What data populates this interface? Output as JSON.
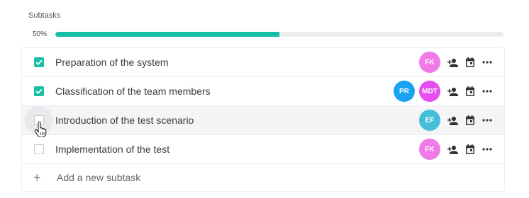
{
  "section": {
    "title": "Subtasks"
  },
  "progress": {
    "label": "50%",
    "value": 0.5,
    "color": "#16bfa6"
  },
  "subtasks": [
    {
      "label": "Preparation of the system",
      "checked": true,
      "avatars": [
        {
          "initials": "FK",
          "color": "#f07ae6"
        }
      ]
    },
    {
      "label": "Classification of the team members",
      "checked": true,
      "avatars": [
        {
          "initials": "PR",
          "color": "#1aa3f0"
        },
        {
          "initials": "MDT",
          "color": "#e64ef0"
        }
      ]
    },
    {
      "label": "Introduction of the test scenario",
      "checked": false,
      "hovered": true,
      "avatars": [
        {
          "initials": "EF",
          "color": "#45bfd8"
        }
      ]
    },
    {
      "label": "Implementation of the test",
      "checked": false,
      "avatars": [
        {
          "initials": "FK",
          "color": "#f07ae6"
        }
      ]
    }
  ],
  "add_subtask": {
    "icon": "plus-icon",
    "label": "Add a new subtask"
  },
  "row_icons": [
    "add-person-icon",
    "calendar-icon",
    "more-icon"
  ]
}
